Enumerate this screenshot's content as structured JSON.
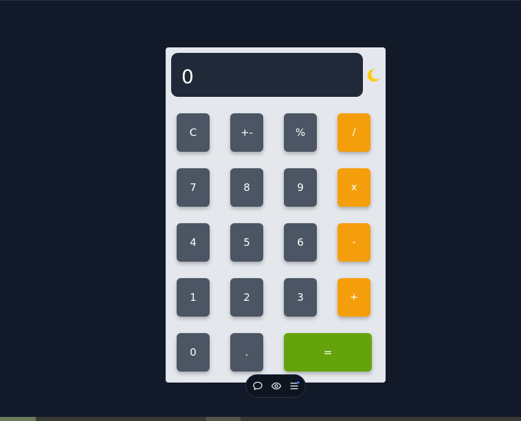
{
  "display": {
    "value": "0"
  },
  "theme_toggle": {
    "icon": "moon-icon",
    "color": "#facc15"
  },
  "keypad": {
    "row1": [
      "C",
      "+-",
      "%",
      "/"
    ],
    "row2": [
      "7",
      "8",
      "9",
      "x"
    ],
    "row3": [
      "4",
      "5",
      "6",
      "-"
    ],
    "row4": [
      "1",
      "2",
      "3",
      "+"
    ],
    "row5": [
      "0",
      ".",
      "="
    ]
  },
  "colors": {
    "number_key": "#4b5563",
    "operator_key": "#f59e0b",
    "equals_key": "#65a30d",
    "panel": "#e4e7ec",
    "display": "#1f2937"
  },
  "toolbar": {
    "icons": [
      "comment-icon",
      "eye-icon",
      "menu-icon"
    ]
  }
}
